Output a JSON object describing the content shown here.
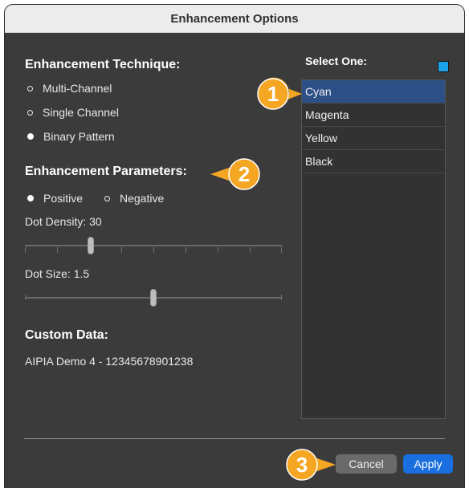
{
  "window": {
    "title": "Enhancement Options"
  },
  "technique": {
    "heading": "Enhancement Technique:",
    "options": [
      {
        "label": "Multi-Channel",
        "selected": false
      },
      {
        "label": "Single Channel",
        "selected": false
      },
      {
        "label": "Binary Pattern",
        "selected": true
      }
    ]
  },
  "parameters": {
    "heading": "Enhancement Parameters:",
    "polarity": [
      {
        "label": "Positive",
        "selected": true
      },
      {
        "label": "Negative",
        "selected": false
      }
    ],
    "dot_density": {
      "label": "Dot Density: 30",
      "value": 30
    },
    "dot_size": {
      "label": "Dot Size: 1.5",
      "value": 1.5
    }
  },
  "custom_data": {
    "heading": "Custom Data:",
    "value": "AIPIA Demo 4 - 12345678901238"
  },
  "select_one": {
    "label": "Select One:",
    "swatch_color": "#1aa3e8",
    "items": [
      {
        "label": "Cyan",
        "selected": true
      },
      {
        "label": "Magenta",
        "selected": false
      },
      {
        "label": "Yellow",
        "selected": false
      },
      {
        "label": "Black",
        "selected": false
      }
    ]
  },
  "buttons": {
    "cancel": "Cancel",
    "apply": "Apply"
  },
  "callouts": {
    "one": "1",
    "two": "2",
    "three": "3",
    "color": "#f5a623"
  }
}
